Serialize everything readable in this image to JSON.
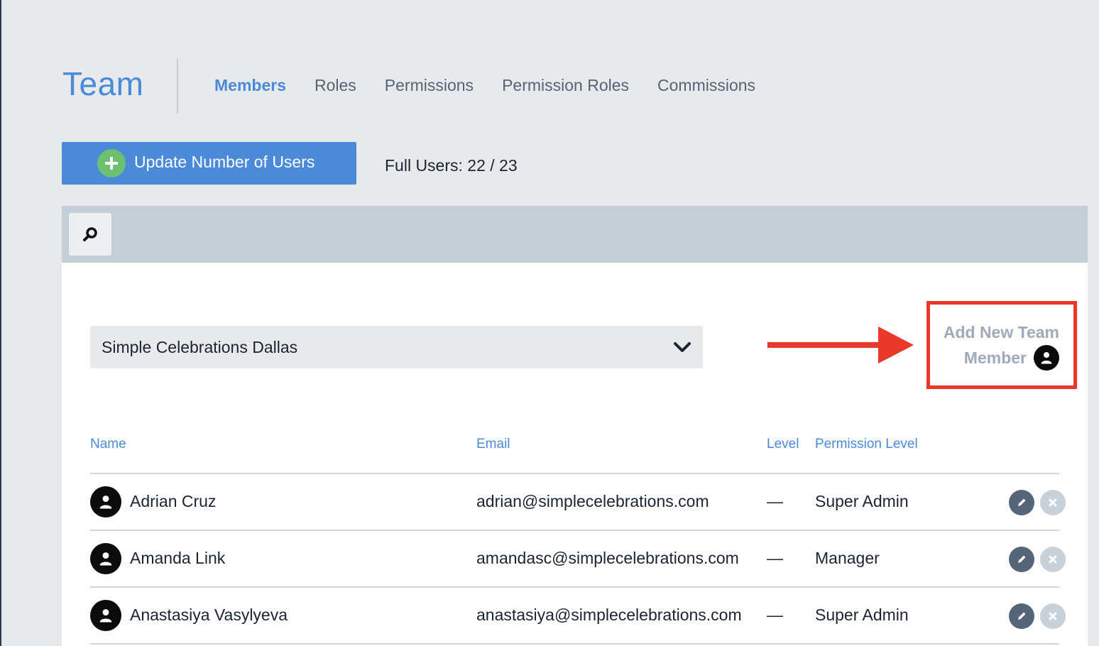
{
  "header": {
    "title": "Team",
    "tabs": [
      {
        "label": "Members",
        "active": true
      },
      {
        "label": "Roles",
        "active": false
      },
      {
        "label": "Permissions",
        "active": false
      },
      {
        "label": "Permission Roles",
        "active": false
      },
      {
        "label": "Commissions",
        "active": false
      }
    ]
  },
  "toolbar": {
    "update_users_label": "Update Number of Users",
    "full_users_text": "Full Users: 22 / 23"
  },
  "filter": {
    "location_selected": "Simple Celebrations Dallas"
  },
  "add_member": {
    "line1": "Add New Team",
    "line2": "Member"
  },
  "table": {
    "columns": [
      "Name",
      "Email",
      "Level",
      "Permission Level"
    ],
    "rows": [
      {
        "name": "Adrian Cruz",
        "email": "adrian@simplecelebrations.com",
        "level": "—",
        "permission": "Super Admin"
      },
      {
        "name": "Amanda Link",
        "email": "amandasc@simplecelebrations.com",
        "level": "—",
        "permission": "Manager"
      },
      {
        "name": "Anastasiya Vasylyeva",
        "email": "anastasiya@simplecelebrations.com",
        "level": "—",
        "permission": "Super Admin"
      }
    ]
  },
  "colors": {
    "accent": "#4a8ad9",
    "highlight": "#e8392b",
    "plus_green": "#6cc06f"
  },
  "icons": [
    "search-icon",
    "plus-icon",
    "chevron-down-icon",
    "user-icon",
    "pencil-icon",
    "close-icon",
    "arrow-right-icon"
  ]
}
